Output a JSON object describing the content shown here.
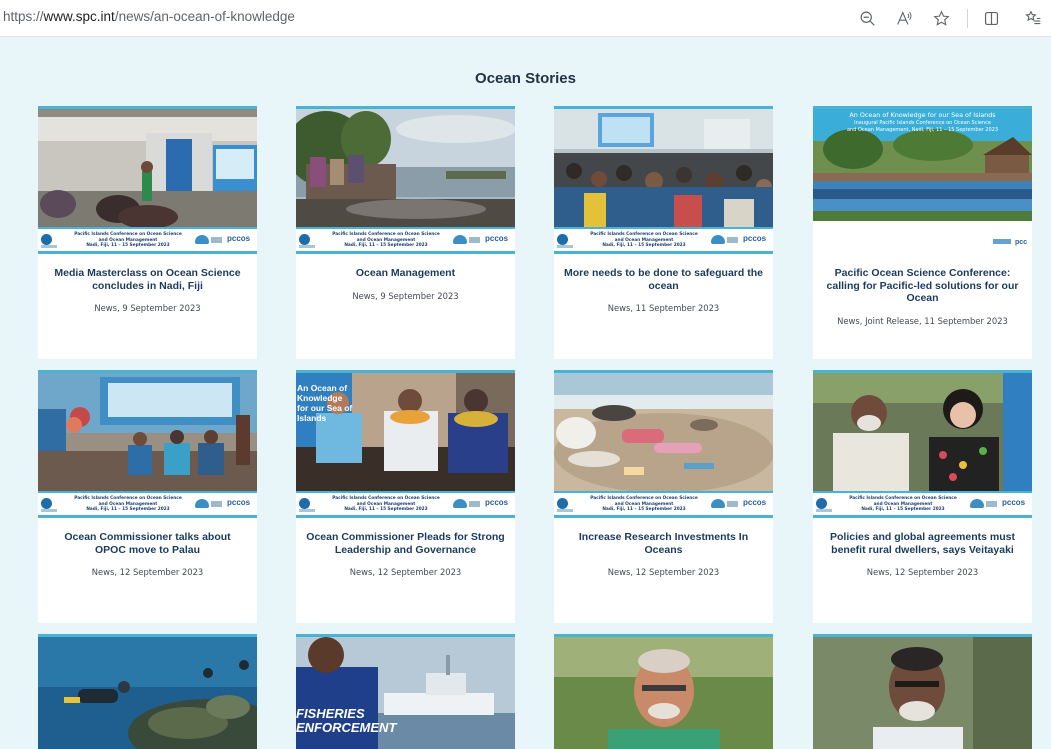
{
  "browser": {
    "url_prefix": "https://",
    "url_domain": "www.spc.int",
    "url_path": "/news/an-ocean-of-knowledge",
    "icons": [
      "zoom-out-icon",
      "read-aloud-icon",
      "favorite-star-icon",
      "split-screen-icon",
      "favorites-list-icon"
    ]
  },
  "page": {
    "section_title": "Ocean Stories",
    "conference_banner": {
      "line1": "Pacific Islands Conference on Ocean Science",
      "line2": "and Ocean Management",
      "line3": "Nadi, Fiji, 11 – 15 September 2023",
      "brand": "pccos"
    },
    "overlay_texts": {
      "card4_header_line1": "An Ocean of Knowledge for our Sea of Islands",
      "card4_header_line2": "Inaugural Pacific Islands Conference on Ocean Science",
      "card4_header_line3": "and Ocean Management, Nadi, Fiji, 11 – 15 September 2023",
      "card10_vest": "FISHERIES",
      "card10_vest2": "ENFORCEMENT",
      "card6_sign": "An Ocean of Knowledge for our Sea of Islands"
    }
  },
  "cards": [
    {
      "title": "Media Masterclass on Ocean Science concludes in Nadi, Fiji",
      "meta": "News, 9 September 2023"
    },
    {
      "title": "Ocean Management",
      "meta": "News, 9 September 2023"
    },
    {
      "title": "More needs to be done to safeguard the ocean",
      "meta": "News, 11 September 2023"
    },
    {
      "title": "Pacific Ocean Science Conference: calling for Pacific-led solutions for our Ocean",
      "meta": "News, Joint Release, 11 September 2023"
    },
    {
      "title": "Ocean Commissioner talks about OPOC move to Palau",
      "meta": "News, 12 September 2023"
    },
    {
      "title": "Ocean Commissioner Pleads for Strong Leadership and Governance",
      "meta": "News, 12 September 2023"
    },
    {
      "title": "Increase Research Investments In Oceans",
      "meta": "News, 12 September 2023"
    },
    {
      "title": "Policies and global agreements must benefit rural dwellers, says Veitayaki",
      "meta": "News, 12 September 2023"
    }
  ],
  "colors": {
    "page_background": "#e8f5f9",
    "card_accent": "#49b3d3",
    "title_text": "#1c3a5e"
  }
}
